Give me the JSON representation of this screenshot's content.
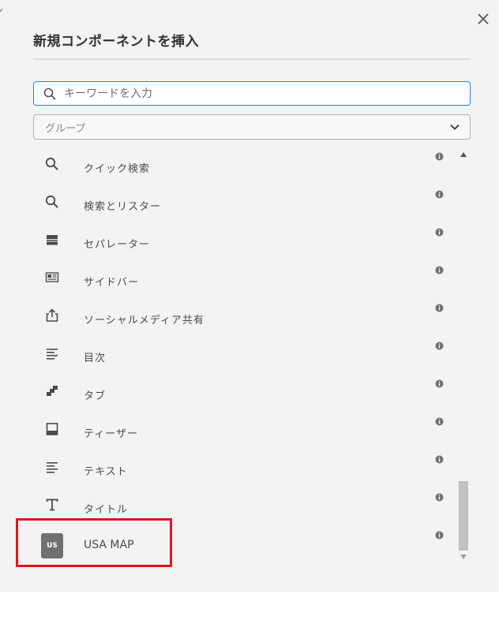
{
  "dialog": {
    "title": "新規コンポーネントを挿入",
    "close_icon": "close-icon"
  },
  "search": {
    "placeholder": "キーワードを入力",
    "icon": "search-icon"
  },
  "group": {
    "label": "グループ",
    "icon": "chevron-down-icon"
  },
  "components": [
    {
      "label": "クイック検索",
      "icon": "search-icon"
    },
    {
      "label": "検索とリスター",
      "icon": "search-icon"
    },
    {
      "label": "セパレーター",
      "icon": "separator-icon"
    },
    {
      "label": "サイドバー",
      "icon": "sidebar-icon"
    },
    {
      "label": "ソーシャルメディア共有",
      "icon": "share-icon"
    },
    {
      "label": "目次",
      "icon": "text-lines-icon"
    },
    {
      "label": "タブ",
      "icon": "tabs-icon"
    },
    {
      "label": "ティーザー",
      "icon": "teaser-icon"
    },
    {
      "label": "テキスト",
      "icon": "text-lines-icon"
    },
    {
      "label": "タイトル",
      "icon": "title-icon"
    },
    {
      "label": "USA MAP",
      "badge": "US"
    }
  ],
  "colors": {
    "background": "#f3f3f3",
    "accent": "#2680eb",
    "highlight": "#e3141f"
  }
}
